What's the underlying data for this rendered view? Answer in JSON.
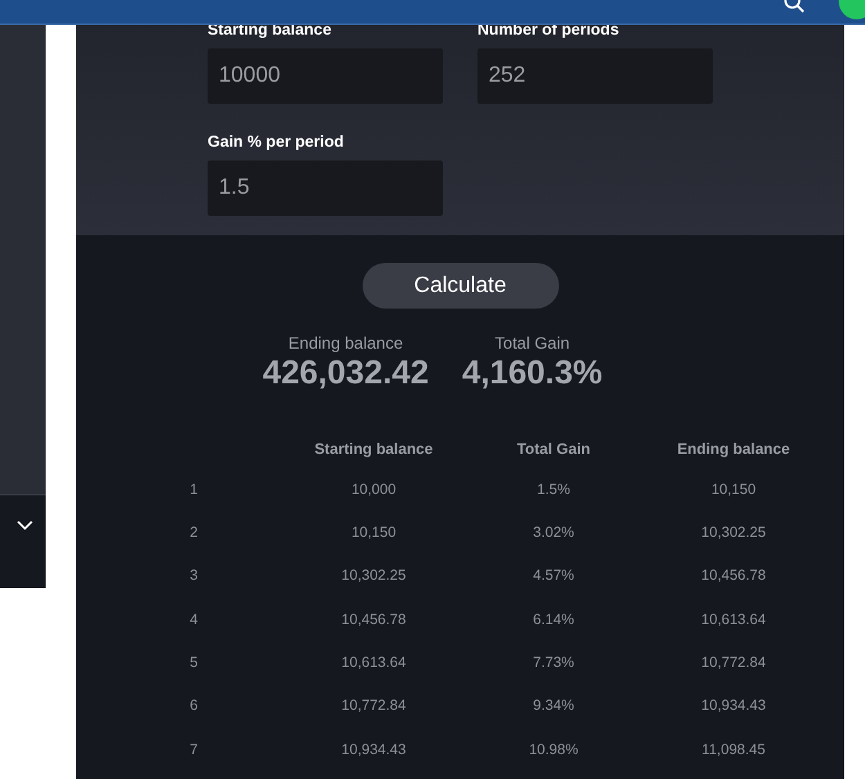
{
  "inputs": [
    {
      "label": "Starting balance",
      "value": "10000"
    },
    {
      "label": "Number of periods",
      "value": "252"
    },
    {
      "label": "Gain % per period",
      "value": "1.5"
    }
  ],
  "calculate_button": "Calculate",
  "results": [
    {
      "label": "Ending balance",
      "value": "426,032.42"
    },
    {
      "label": "Total Gain",
      "value": "4,160.3%"
    }
  ],
  "table": {
    "columns": [
      "",
      "Starting balance",
      "Total Gain",
      "Ending balance"
    ],
    "rows": [
      [
        "1",
        "10,000",
        "1.5%",
        "10,150"
      ],
      [
        "2",
        "10,150",
        "3.02%",
        "10,302.25"
      ],
      [
        "3",
        "10,302.25",
        "4.57%",
        "10,456.78"
      ],
      [
        "4",
        "10,456.78",
        "6.14%",
        "10,613.64"
      ],
      [
        "5",
        "10,613.64",
        "7.73%",
        "10,772.84"
      ],
      [
        "6",
        "10,772.84",
        "9.34%",
        "10,934.43"
      ],
      [
        "7",
        "10,934.43",
        "10.98%",
        "11,098.45"
      ]
    ]
  }
}
